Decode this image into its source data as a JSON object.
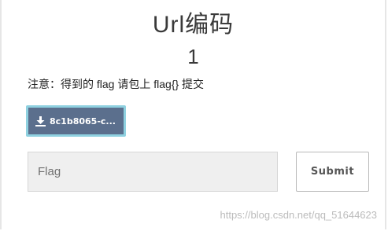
{
  "challenge": {
    "title": "Url编码",
    "points": "1",
    "notice": "注意：得到的 flag 请包上 flag{} 提交",
    "download_label": "8c1b8065-c..."
  },
  "form": {
    "flag_placeholder": "Flag",
    "flag_value": "",
    "submit_label": "Submit"
  },
  "watermark": "https://blog.csdn.net/qq_51644623",
  "icons": {
    "download": "download-icon"
  },
  "colors": {
    "download_bg": "#5b6f8d",
    "download_border": "#8fd1e0",
    "input_bg": "#efefef"
  }
}
